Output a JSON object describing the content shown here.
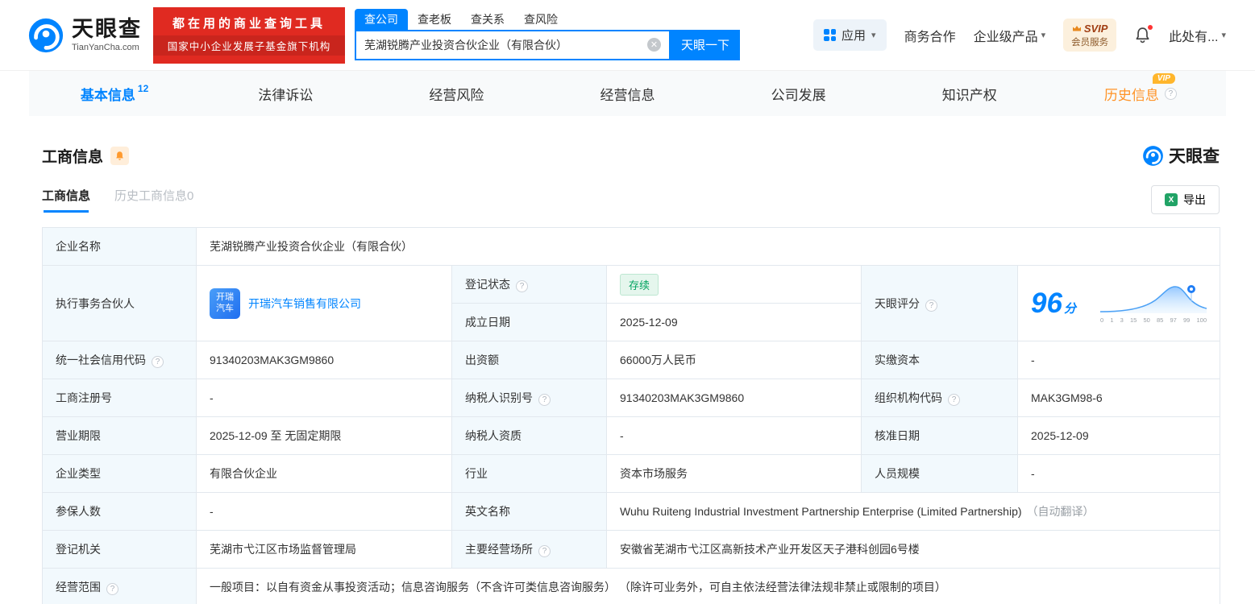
{
  "colors": {
    "brand_blue": "#0084ff",
    "banner_red": "#e02a21",
    "status_green": "#00a35f",
    "history_orange": "#ff9326",
    "label_bg": "#f2f9fd"
  },
  "icons": {
    "caret_down": "▾",
    "clear": "✕",
    "question": "?",
    "excel": "X"
  },
  "header": {
    "logo_title": "天眼查",
    "logo_subtitle": "TianYanCha.com",
    "banner_line1": "都在用的商业查询工具",
    "banner_line2": "国家中小企业发展子基金旗下机构",
    "search_tabs": [
      {
        "label": "查公司",
        "active": true
      },
      {
        "label": "查老板",
        "active": false
      },
      {
        "label": "查关系",
        "active": false
      },
      {
        "label": "查风险",
        "active": false
      }
    ],
    "search_value": "芜湖锐腾产业投资合伙企业（有限合伙）",
    "search_button": "天眼一下",
    "apps_label": "应用",
    "nav_cooperation": "商务合作",
    "nav_enterprise": "企业级产品",
    "vip_title": "SVIP",
    "vip_subtitle": "会员服务",
    "more_label": "此处有..."
  },
  "tabs": [
    {
      "label": "基本信息",
      "count": "12",
      "active": true
    },
    {
      "label": "法律诉讼"
    },
    {
      "label": "经营风险"
    },
    {
      "label": "经营信息"
    },
    {
      "label": "公司发展"
    },
    {
      "label": "知识产权"
    },
    {
      "label": "历史信息",
      "vip": "VIP"
    }
  ],
  "section": {
    "title": "工商信息",
    "brand": "天眼查",
    "subtab_current": "工商信息",
    "subtab_history": "历史工商信息0",
    "export_label": "导出"
  },
  "info": {
    "name": {
      "label": "企业名称",
      "value": "芜湖锐腾产业投资合伙企业（有限合伙）"
    },
    "partner": {
      "label": "执行事务合伙人",
      "logo_line1": "开瑞",
      "logo_line2": "汽车",
      "company": "开瑞汽车销售有限公司"
    },
    "status": {
      "label": "登记状态",
      "value": "存续"
    },
    "established": {
      "label": "成立日期",
      "value": "2025-12-09"
    },
    "score": {
      "label": "天眼评分",
      "value": "96",
      "unit": "分",
      "axis": [
        "0",
        "1",
        "3",
        "15",
        "50",
        "85",
        "97",
        "99",
        "100"
      ]
    },
    "credit_code": {
      "label": "统一社会信用代码",
      "value": "91340203MAK3GM9860"
    },
    "capital": {
      "label": "出资额",
      "value": "66000万人民币"
    },
    "paid_in": {
      "label": "实缴资本",
      "value": "-"
    },
    "reg_no": {
      "label": "工商注册号",
      "value": "-"
    },
    "taxpayer_no": {
      "label": "纳税人识别号",
      "value": "91340203MAK3GM9860"
    },
    "org_code": {
      "label": "组织机构代码",
      "value": "MAK3GM98-6"
    },
    "term": {
      "label": "营业期限",
      "value": "2025-12-09 至 无固定期限"
    },
    "taxpayer_quality": {
      "label": "纳税人资质",
      "value": "-"
    },
    "approved": {
      "label": "核准日期",
      "value": "2025-12-09"
    },
    "type": {
      "label": "企业类型",
      "value": "有限合伙企业"
    },
    "industry": {
      "label": "行业",
      "value": "资本市场服务"
    },
    "staff": {
      "label": "人员规模",
      "value": "-"
    },
    "insured": {
      "label": "参保人数",
      "value": "-"
    },
    "english": {
      "label": "英文名称",
      "value": "Wuhu Ruiteng Industrial Investment Partnership Enterprise (Limited Partnership)",
      "note": "（自动翻译）"
    },
    "authority": {
      "label": "登记机关",
      "value": "芜湖市弋江区市场监督管理局"
    },
    "premises": {
      "label": "主要经营场所",
      "value": "安徽省芜湖市弋江区高新技术产业开发区天子港科创园6号楼"
    },
    "scope": {
      "label": "经营范围",
      "value": "一般项目：以自有资金从事投资活动；信息咨询服务（不含许可类信息咨询服务） （除许可业务外，可自主依法经营法律法规非禁止或限制的项目）"
    }
  }
}
